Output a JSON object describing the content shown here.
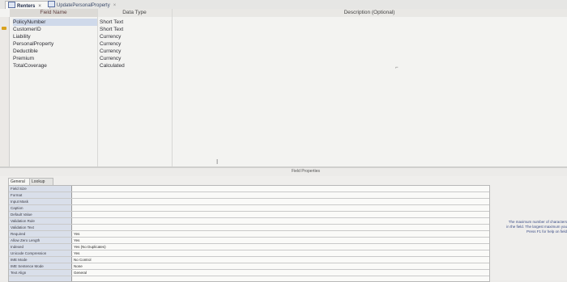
{
  "tabs": [
    {
      "label": "Renters",
      "close": "×"
    },
    {
      "label": "UpdatePersonalProperty",
      "close": "×"
    }
  ],
  "grid": {
    "headers": {
      "field": "Field Name",
      "type": "Data Type",
      "description": "Description (Optional)"
    },
    "rows": [
      {
        "name": "PolicyNumber",
        "type": "Short Text"
      },
      {
        "name": "CustomerID",
        "type": "Short Text"
      },
      {
        "name": "Liability",
        "type": "Currency"
      },
      {
        "name": "PersonalProperty",
        "type": "Currency"
      },
      {
        "name": "Deductible",
        "type": "Currency"
      },
      {
        "name": "Premium",
        "type": "Currency"
      },
      {
        "name": "TotalCoverage",
        "type": "Calculated"
      }
    ],
    "cursor_glyph": "I"
  },
  "field_properties": {
    "title": "Field Properties",
    "tabs": [
      "General",
      "Lookup"
    ],
    "rows": [
      {
        "name": "Field Size",
        "value": ""
      },
      {
        "name": "Format",
        "value": ""
      },
      {
        "name": "Input Mask",
        "value": ""
      },
      {
        "name": "Caption",
        "value": ""
      },
      {
        "name": "Default Value",
        "value": ""
      },
      {
        "name": "Validation Rule",
        "value": ""
      },
      {
        "name": "Validation Text",
        "value": ""
      },
      {
        "name": "Required",
        "value": "Yes"
      },
      {
        "name": "Allow Zero Length",
        "value": "Yes"
      },
      {
        "name": "Indexed",
        "value": "Yes (No Duplicates)"
      },
      {
        "name": "Unicode Compression",
        "value": "Yes"
      },
      {
        "name": "IME Mode",
        "value": "No Control"
      },
      {
        "name": "IME Sentence Mode",
        "value": "None"
      },
      {
        "name": "Text Align",
        "value": "General"
      }
    ],
    "help_text": [
      "The maximum number of characters",
      "in the field. The largest maximum you",
      "Press F1 for help on field"
    ]
  }
}
